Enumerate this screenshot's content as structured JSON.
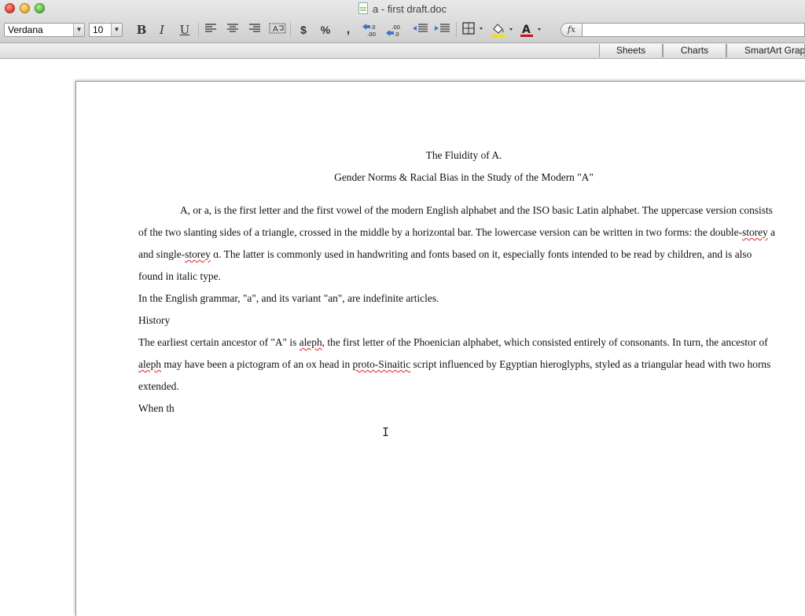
{
  "window": {
    "title": "a - first draft.doc",
    "close_color": "#e0443a",
    "minimize_color": "#e7b13a",
    "zoom_color": "#5fbd44"
  },
  "toolbar": {
    "font_name": "Verdana",
    "font_size": "10",
    "bold_label": "B",
    "italic_label": "I",
    "underline_label": "U",
    "currency_label": "$",
    "percent_label": "%",
    "comma_label": ",",
    "formula_label": "fx",
    "icons": [
      "align-left-icon",
      "align-center-icon",
      "align-right-icon",
      "wrap-text-icon",
      "increase-decimal-icon",
      "decrease-decimal-icon",
      "decrease-indent-icon",
      "increase-indent-icon",
      "borders-icon",
      "fill-color-icon",
      "font-color-icon"
    ],
    "fill_color": "#f2e200",
    "font_color": "#d01010"
  },
  "gallery_tabs": [
    "Sheets",
    "Charts",
    "SmartArt Grap"
  ],
  "document": {
    "title": "The Fluidity of A.",
    "subtitle": "Gender Norms & Racial Bias in the Study of the Modern \"A\"",
    "p1_l1": "A, or a, is the first letter and the first vowel of the modern English alphabet and the ISO basic Latin alphabet. The uppercase version consists",
    "p1_l2a": "of the two slanting sides of a triangle, crossed in the middle by a horizontal bar. The lowercase version can be written in two forms: the double-",
    "p1_l2b": "storey",
    "p1_l2c": " a",
    "p1_l3a": "and single-",
    "p1_l3b": "storey",
    "p1_l3c": " ɑ. The latter is commonly used in handwriting and fonts based on it, especially fonts intended to be read by children, and is also",
    "p1_l4": "found in italic type.",
    "p2": "In the English grammar, \"a\", and its variant \"an\", are indefinite articles.",
    "heading": "History",
    "p3_l1a": "The earliest certain ancestor of \"A\" is ",
    "p3_l1b": "aleph",
    "p3_l1c": ", the first letter of the Phoenician alphabet, which consisted entirely of consonants. In turn, the ancestor of",
    "p3_l2a": "aleph",
    "p3_l2b": " may have been a pictogram of an ox head in ",
    "p3_l2c": "proto-Sinaitic",
    "p3_l2d": " script influenced by Egyptian hieroglyphs, styled as a triangular head with two horns",
    "p3_l3": "extended.",
    "p4": "When th"
  }
}
